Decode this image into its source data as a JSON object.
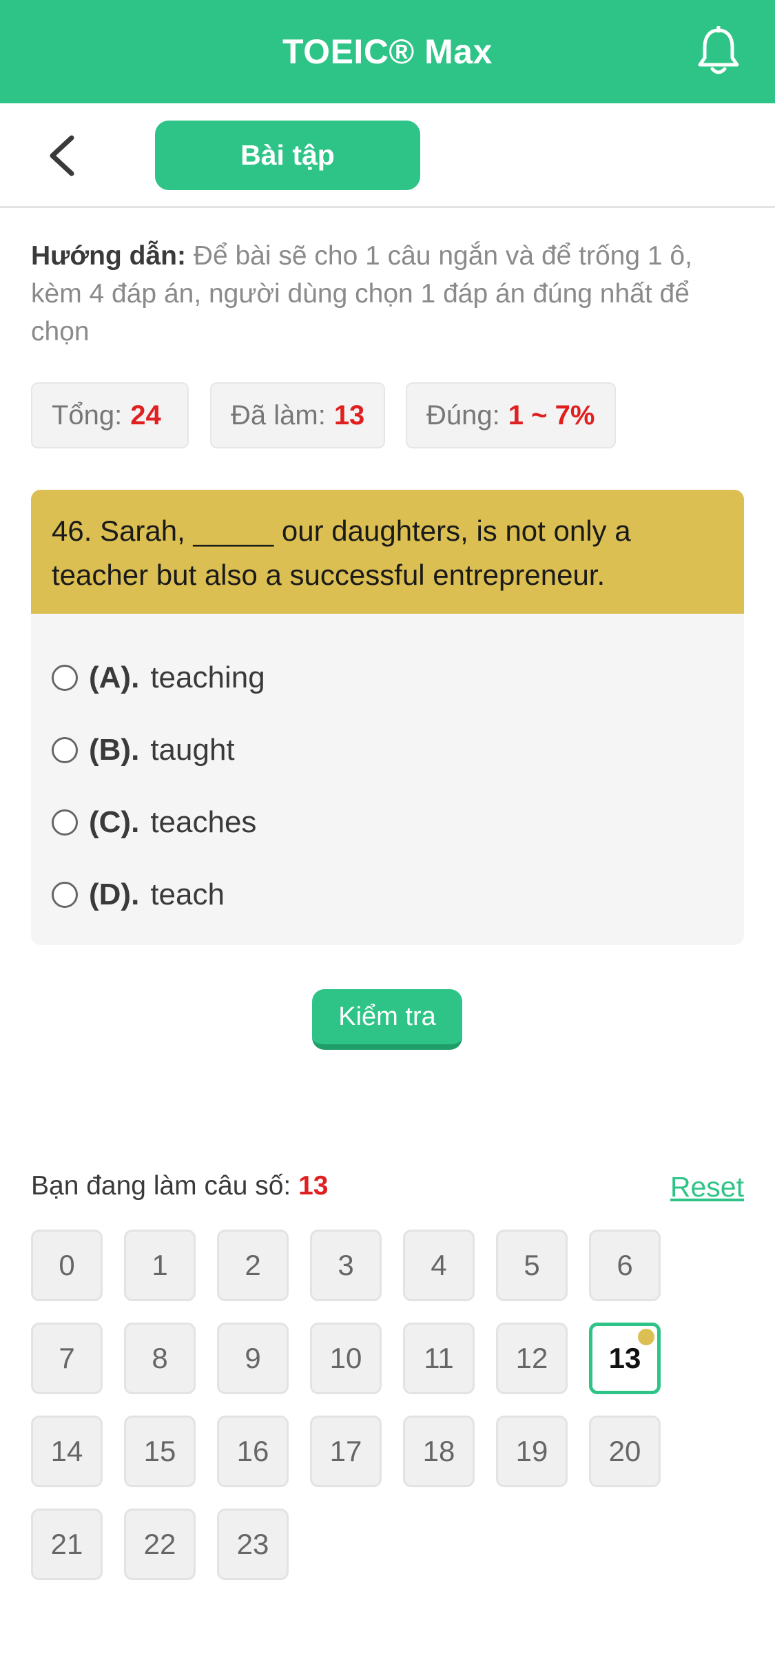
{
  "header": {
    "title": "TOEIC® Max",
    "icon": "bell-icon",
    "color": "#2ec487"
  },
  "subbar": {
    "back_icon": "chevron-left-icon",
    "tab_label": "Bài tập"
  },
  "guide": {
    "label": "Hướng dẫn:",
    "text": "Để bài sẽ cho 1 câu ngắn và để trống 1 ô, kèm 4 đáp án, người dùng chọn 1 đáp án đúng nhất để chọn"
  },
  "stats": [
    {
      "label": "Tổng:",
      "value": "24"
    },
    {
      "label": "Đã làm:",
      "value": "13"
    },
    {
      "label": "Đúng:",
      "value": "1 ~ 7%"
    }
  ],
  "question": {
    "text": "46. Sarah, _____ our daughters, is not only a teacher but also a successful entrepreneur.",
    "options": [
      {
        "key": "(A).",
        "text": "teaching"
      },
      {
        "key": "(B).",
        "text": "taught"
      },
      {
        "key": "(C).",
        "text": "teaches"
      },
      {
        "key": "(D).",
        "text": "teach"
      }
    ]
  },
  "check_label": "Kiểm tra",
  "progress": {
    "label": "Bạn đang làm câu số:",
    "current": "13",
    "reset_label": "Reset"
  },
  "grid": [
    "0",
    "1",
    "2",
    "3",
    "4",
    "5",
    "6",
    "7",
    "8",
    "9",
    "10",
    "11",
    "12",
    "13",
    "14",
    "15",
    "16",
    "17",
    "18",
    "19",
    "20",
    "21",
    "22",
    "23"
  ],
  "active_index": 13
}
